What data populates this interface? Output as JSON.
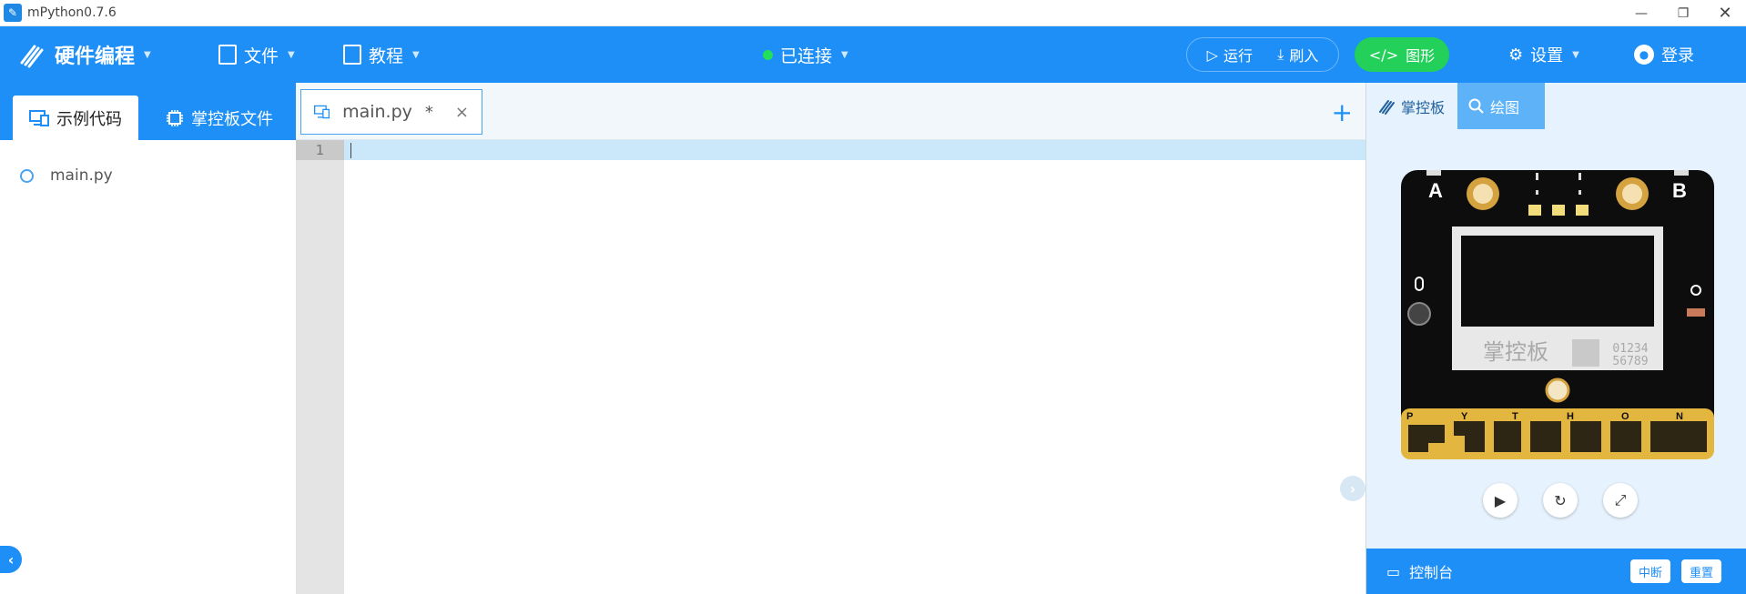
{
  "window": {
    "title": "mPython0.7.6",
    "controls": {
      "minimize": "—",
      "maximize": "❐",
      "close": "✕"
    }
  },
  "toolbar": {
    "brand": "硬件编程",
    "file_menu": "文件",
    "tutorial_menu": "教程",
    "connection_status": "已连接",
    "run_label": "运行",
    "flash_label": "刷入",
    "graphic_label": "图形",
    "settings_label": "设置",
    "login_label": "登录",
    "colors": {
      "primary": "#1e8ff7",
      "connected_dot": "#22e05a",
      "graphic_button": "#22d05a"
    }
  },
  "left_panel": {
    "tabs": [
      {
        "label": "示例代码",
        "active": true,
        "icon": "monitor-icon"
      },
      {
        "label": "掌控板文件",
        "active": false,
        "icon": "chip-icon"
      }
    ],
    "files": [
      {
        "name": "main.py",
        "icon": "python-icon"
      }
    ]
  },
  "editor": {
    "tabs": [
      {
        "label": "main.py",
        "modified_marker": "*",
        "close": "×",
        "icon": "monitor-icon"
      }
    ],
    "add_tab": "+",
    "lines": [
      {
        "number": "1",
        "text": ""
      }
    ]
  },
  "right_panel": {
    "tabs": [
      {
        "label": "掌控板",
        "active": true,
        "icon": "board-logo-icon"
      },
      {
        "label": "绘图",
        "active": false,
        "icon": "search-icon"
      }
    ],
    "board": {
      "left_button": "A",
      "right_button": "B",
      "brand_text": "掌控板",
      "serial_line1": "01234",
      "serial_line2": "56789",
      "pin_letters": [
        "P",
        "Y",
        "T",
        "H",
        "O",
        "N"
      ]
    },
    "console": {
      "label": "控制台",
      "stop": "中断",
      "reset": "重置"
    }
  }
}
